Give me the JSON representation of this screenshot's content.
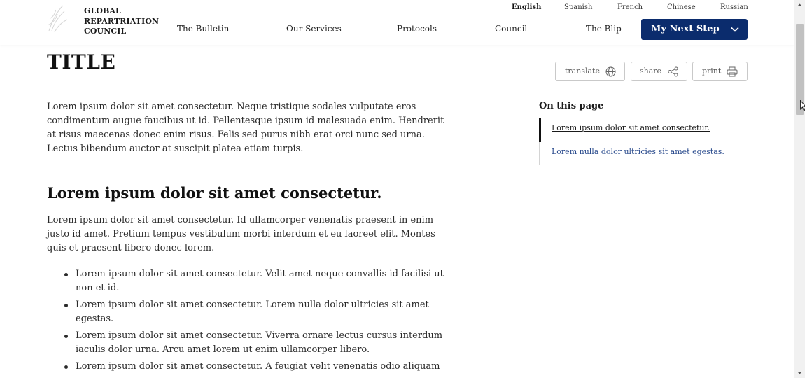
{
  "header": {
    "logo_lines": [
      "GLOBAL",
      "REPARTRIATION",
      "COUNCIL"
    ],
    "languages": [
      "English",
      "Spanish",
      "French",
      "Chinese",
      "Russian"
    ],
    "active_language": "English",
    "nav": [
      "The Bulletin",
      "Our Services",
      "Protocols",
      "Council",
      "The Blip"
    ],
    "cta_label": "My Next Step"
  },
  "page": {
    "title": "TITLE",
    "tools": {
      "translate": "translate",
      "share": "share",
      "print": "print"
    },
    "intro": "Lorem ipsum dolor sit amet consectetur. Neque tristique sodales vulputate eros condimentum augue faucibus ut id. Pellentesque ipsum id malesuada enim. Hendrerit at risus maecenas donec enim risus. Felis sed purus nibh erat orci nunc sed urna. Lectus bibendum auctor at suscipit platea etiam turpis.",
    "section_heading": "Lorem ipsum dolor sit amet consectetur.",
    "section_text": "Lorem ipsum dolor sit amet consectetur. Id ullamcorper venenatis praesent in enim justo id amet. Pretium tempus vestibulum morbi interdum et eu laoreet elit. Montes quis et praesent libero donec lorem.",
    "bullets": [
      "Lorem ipsum dolor sit amet consectetur. Velit amet neque convallis id facilisi ut non et id.",
      "Lorem ipsum dolor sit amet consectetur. Lorem nulla dolor ultricies sit amet egestas.",
      "Lorem ipsum dolor sit amet consectetur. Viverra ornare lectus cursus interdum iaculis dolor urna. Arcu amet lorem ut enim ullamcorper libero.",
      "Lorem ipsum dolor sit amet consectetur. A feugiat velit venenatis odio aliquam"
    ]
  },
  "on_this_page": {
    "heading": "On this page",
    "links": [
      "Lorem ipsum dolor sit amet consectetur.",
      "Lorem nulla dolor ultricies sit amet egestas."
    ]
  },
  "colors": {
    "cta_background": "#0b2c6d",
    "link_blue": "#2a4b8d",
    "rule_gray": "#8a8a8a"
  },
  "icons": {
    "logo": "council-logo-icon",
    "cta": "chevron-down-icon",
    "translate": "globe-icon",
    "share": "share-icon",
    "print": "printer-icon"
  }
}
